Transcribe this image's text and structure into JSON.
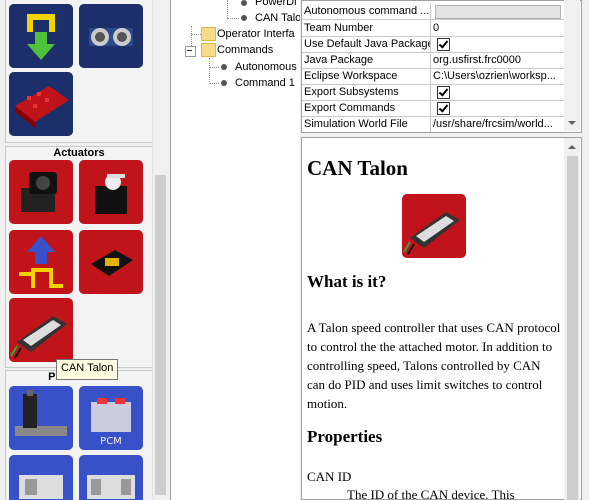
{
  "palette": {
    "sections": [
      {
        "title": ""
      },
      {
        "title": "Actuators"
      },
      {
        "title": "Pneumatics"
      }
    ],
    "tiles": [
      {
        "name": "digital-input-icon"
      },
      {
        "name": "ultrasonic-sensor-icon"
      },
      {
        "name": "pdp-board-icon"
      },
      {
        "name": "gearmotor-icon"
      },
      {
        "name": "servo-icon"
      },
      {
        "name": "digital-output-icon"
      },
      {
        "name": "relay-icon"
      },
      {
        "name": "can-talon-icon"
      },
      {
        "name": "pneumatic-cylinder-icon"
      },
      {
        "name": "pcm-icon"
      },
      {
        "name": "solenoid-icon"
      },
      {
        "name": "double-solenoid-icon"
      }
    ],
    "tooltip": "CAN Talon"
  },
  "tree": {
    "rows": [
      {
        "label": "PowerDi"
      },
      {
        "label": "CAN Talo"
      },
      {
        "label": "Operator Interfa"
      },
      {
        "label": "Commands"
      },
      {
        "label": "Autonomous"
      },
      {
        "label": "Command 1"
      }
    ]
  },
  "properties": {
    "rows": [
      {
        "key": "Autonomous command ...",
        "value": "",
        "kind": "grey"
      },
      {
        "key": "Team Number",
        "value": "0",
        "kind": "text"
      },
      {
        "key": "Use Default Java Package",
        "value": "",
        "kind": "check"
      },
      {
        "key": "Java Package",
        "value": "org.usfirst.frc0000",
        "kind": "text"
      },
      {
        "key": "Eclipse Workspace",
        "value": "C:\\Users\\ozrien\\worksp...",
        "kind": "text"
      },
      {
        "key": "Export Subsystems",
        "value": "",
        "kind": "check"
      },
      {
        "key": "Export Commands",
        "value": "",
        "kind": "check"
      },
      {
        "key": "Simulation World File",
        "value": "/usr/share/frcsim/world...",
        "kind": "text"
      }
    ]
  },
  "doc": {
    "title": "CAN Talon",
    "what_heading": "What is it?",
    "description": "A Talon speed controller that uses CAN protocol to control the the attached motor. In addition to controlling speed, Talons controlled by CAN can do PID and uses limit switches to control motion.",
    "properties_heading": "Properties",
    "prop_name": "CAN ID",
    "prop_desc": "The ID of the CAN device. This"
  },
  "colors": {
    "tile_red": "#c0141a",
    "tile_navy": "#1c2f6a",
    "tile_blue": "#3850c8"
  }
}
